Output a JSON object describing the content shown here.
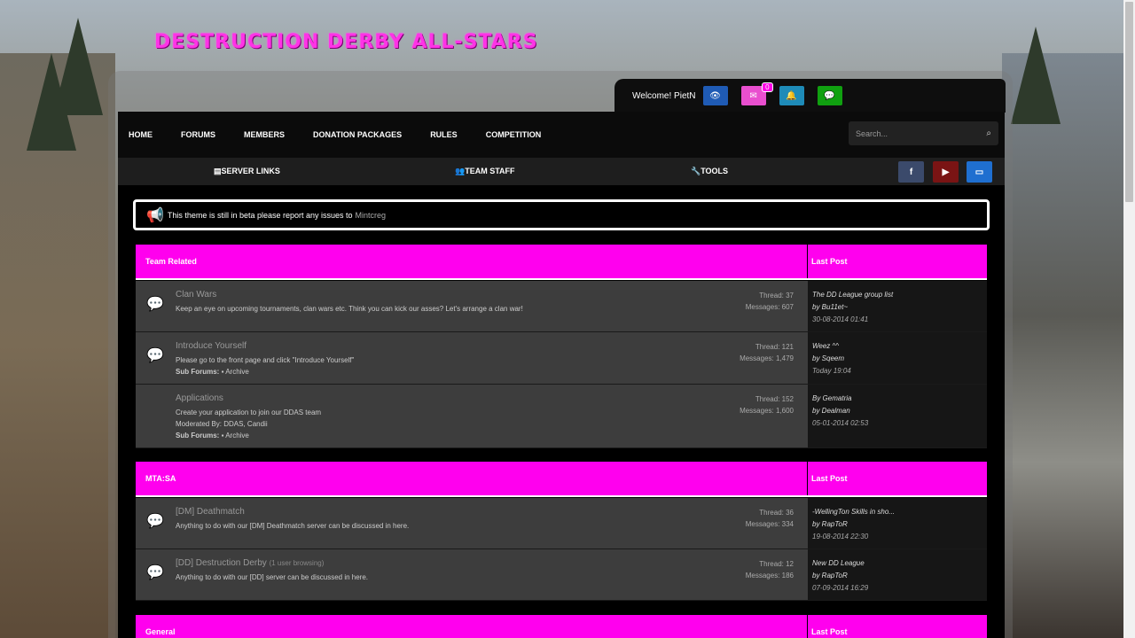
{
  "site": {
    "title": "DESTRUCTION DERBY ALL-STARS"
  },
  "user_bar": {
    "welcome": "Welcome! PietN",
    "messages_badge": "0",
    "icons": [
      "eye-icon",
      "envelope-icon",
      "bell-icon",
      "chat-icon"
    ],
    "colors": [
      "#1f5bb5",
      "#e94fcf",
      "#1e8bb8",
      "#10a010"
    ]
  },
  "nav": {
    "items": [
      "HOME",
      "FORUMS",
      "MEMBERS",
      "DONATION PACKAGES",
      "RULES",
      "COMPETITION"
    ],
    "search_placeholder": "Search..."
  },
  "subnav": {
    "server_links": "SERVER LINKS",
    "team_staff": "TEAM STAFF",
    "tools": "TOOLS",
    "social": [
      {
        "icon": "facebook-icon",
        "glyph": "f",
        "color": "#3b4a6b"
      },
      {
        "icon": "youtube-icon",
        "glyph": "▶",
        "color": "#7a1414"
      },
      {
        "icon": "desktop-icon",
        "glyph": "▭",
        "color": "#1f6fd0"
      }
    ]
  },
  "notice": {
    "text": "This theme is still in beta please report any issues to",
    "link": "Mintcreg"
  },
  "categories": [
    {
      "title": "Team Related",
      "last_post_label": "Last Post",
      "forums": [
        {
          "icon": "chat-bubble-icon",
          "title": "Clan Wars",
          "description": "Keep an eye on upcoming tournaments, clan wars etc. Think you can kick our asses? Let's arrange a clan war!",
          "threads": "Thread: 37",
          "messages": "Messages: 607",
          "last_post": {
            "title": "The DD League group list",
            "by": "by Bu11et~",
            "date": "30-08-2014 01:41"
          }
        },
        {
          "icon": "chat-bubbles-icon",
          "title": "Introduce Yourself",
          "description": "Please go to the front page and click \"Introduce Yourself\"",
          "subforums_label": "Sub Forums:",
          "subforum": "Archive",
          "threads": "Thread: 121",
          "messages": "Messages: 1,479",
          "last_post": {
            "title": "Weez ^^",
            "by": "by Sqeem",
            "date": "Today 19:04"
          }
        },
        {
          "icon": "none",
          "title": "Applications",
          "description": "Create your application to join our DDAS team",
          "moderated": "Moderated By: DDAS, Candii",
          "subforums_label": "Sub Forums:",
          "subforum": "Archive",
          "threads": "Thread: 152",
          "messages": "Messages: 1,600",
          "last_post": {
            "title": "By Gematria",
            "by": "by Dealman",
            "date": "05-01-2014 02:53"
          }
        }
      ]
    },
    {
      "title": "MTA:SA",
      "last_post_label": "Last Post",
      "forums": [
        {
          "icon": "chat-bubble-icon",
          "title": "[DM] Deathmatch",
          "description": "Anything to do with our [DM] Deathmatch server can be discussed in here.",
          "threads": "Thread: 36",
          "messages": "Messages: 334",
          "last_post": {
            "title": "-WellingTon Skills in sho...",
            "by": "by RapToR",
            "date": "19-08-2014 22:30"
          }
        },
        {
          "icon": "chat-bubbles-icon",
          "title": "[DD] Destruction Derby",
          "browsing": "(1 user browsing)",
          "description": "Anything to do with our [DD] server can be discussed in here.",
          "threads": "Thread: 12",
          "messages": "Messages: 186",
          "last_post": {
            "title": "New DD League",
            "by": "by RapToR",
            "date": "07-09-2014 16:29"
          }
        }
      ]
    },
    {
      "title": "General",
      "last_post_label": "Last Post",
      "forums": []
    }
  ]
}
